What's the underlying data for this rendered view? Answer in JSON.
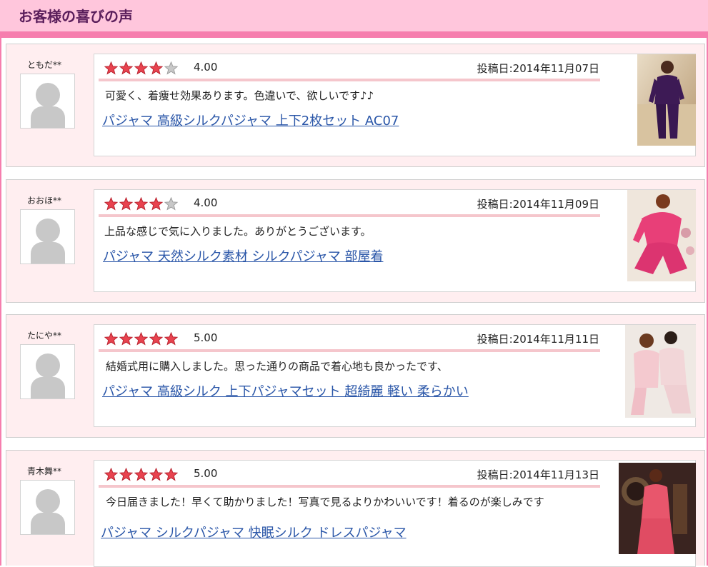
{
  "header": {
    "title": "お客様の喜びの声"
  },
  "colors": {
    "header_bg": "#ffc6dc",
    "header_rule": "#f67eae",
    "title_text": "#5a1e5b",
    "review_bg": "#ffeef0",
    "star_filled": "#e8434f",
    "star_empty": "#c8c8c8",
    "link": "#2a56a8"
  },
  "reviews": [
    {
      "nickname": "ともだ**",
      "rating": 4,
      "rating_text": "4.00",
      "date": "投稿日:2014年11月07日",
      "comment": "可愛く、着痩せ効果あります。色違いで、欲しいです♪♪",
      "product": "パジャマ 高級シルクパジャマ 上下2枚セット AC07",
      "photo_icon": "purple-silk-pajama-photo"
    },
    {
      "nickname": "おおほ**",
      "rating": 4,
      "rating_text": "4.00",
      "date": "投稿日:2014年11月09日",
      "comment": "上品な感じで気に入りました。ありがとうございます。",
      "product": "パジャマ 天然シルク素材 シルクパジャマ 部屋着",
      "photo_icon": "pink-silk-pajama-photo"
    },
    {
      "nickname": "たにや**",
      "rating": 5,
      "rating_text": "5.00",
      "date": "投稿日:2014年11月11日",
      "comment": "結婚式用に購入しました。思った通りの商品で着心地も良かったです、",
      "product": "パジャマ 高級シルク 上下パジャマセット 超綺麗 軽い 柔らかい",
      "photo_icon": "couple-pajama-photo"
    },
    {
      "nickname": "青木舞**",
      "rating": 5,
      "rating_text": "5.00",
      "date": "投稿日:2014年11月13日",
      "comment": "今日届きました！早くて助かりました！写真で見るよりかわいいです！着るのが楽しみです",
      "product": "パジャマ シルクパジャマ 快眠シルク ドレスパジャマ",
      "photo_icon": "dress-pajama-photo"
    }
  ]
}
